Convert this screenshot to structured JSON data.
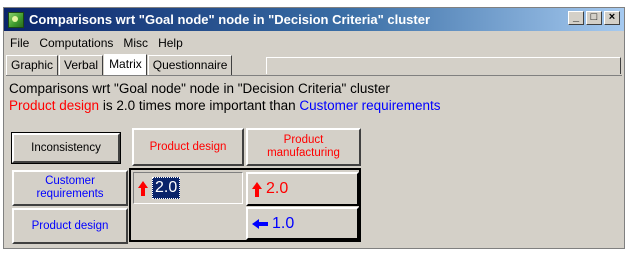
{
  "window": {
    "title": "Comparisons wrt \"Goal node\" node in \"Decision Criteria\" cluster",
    "controls": {
      "minimize": "_",
      "maximize": "□",
      "close": "×"
    }
  },
  "menu": [
    "File",
    "Computations",
    "Misc",
    "Help"
  ],
  "tabs": [
    {
      "label": "Graphic",
      "active": false
    },
    {
      "label": "Verbal",
      "active": false
    },
    {
      "label": "Matrix",
      "active": true
    },
    {
      "label": "Questionnaire",
      "active": false
    }
  ],
  "info": {
    "line1": "Comparisons wrt \"Goal node\" node in \"Decision Criteria\" cluster",
    "line2_a": "Product design",
    "line2_b": " is 2.0 times more important than ",
    "line2_c": "Customer requirements"
  },
  "matrix": {
    "inconsistency_button": "Inconsistency",
    "columns": [
      "Product design",
      "Product manufacturing"
    ],
    "rows": [
      "Customer requirements",
      "Product design"
    ],
    "cells": {
      "r1c1": {
        "value": "2.0",
        "arrow": "up",
        "color": "#ff0000",
        "selected": true
      },
      "r1c2": {
        "value": "2.0",
        "arrow": "up",
        "color": "#ff0000",
        "selected": false
      },
      "r2c2": {
        "value": "1.0",
        "arrow": "left",
        "color": "#0000ff",
        "selected": false
      }
    }
  },
  "colors": {
    "accent_red": "#ff0000",
    "accent_blue": "#0000ff",
    "title_bar": "#0a246a"
  }
}
